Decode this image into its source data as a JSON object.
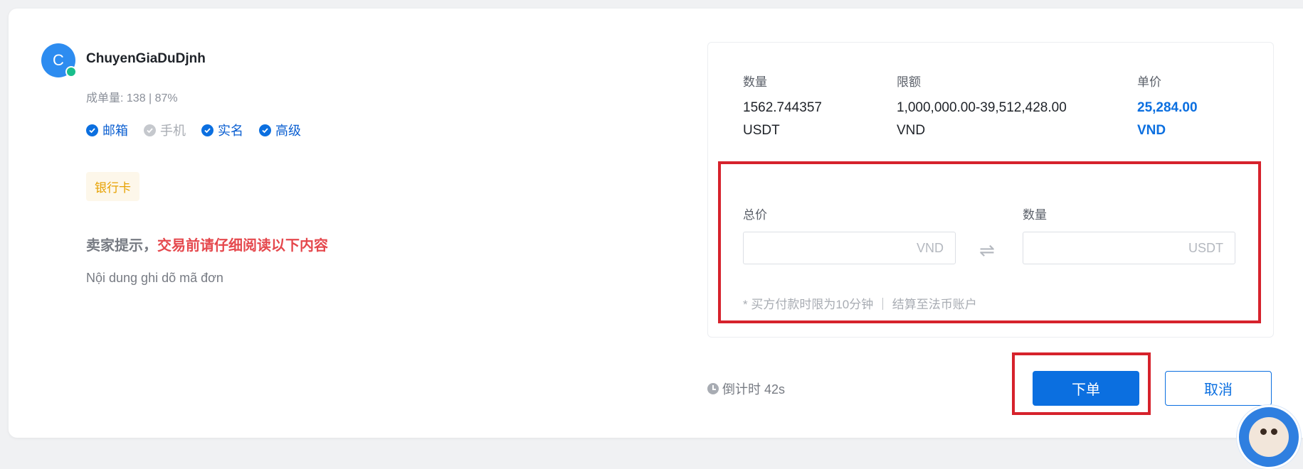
{
  "merchant": {
    "avatar_letter": "C",
    "name": "ChuyenGiaDuDjnh",
    "stats": "成单量: 138 | 87%",
    "verifications": [
      {
        "label": "邮箱",
        "verified": true
      },
      {
        "label": "手机",
        "verified": false
      },
      {
        "label": "实名",
        "verified": true
      },
      {
        "label": "高级",
        "verified": true
      }
    ],
    "payment_method": "银行卡",
    "notice_prefix": "卖家提示，",
    "notice_warning": "交易前请仔细阅读以下内容",
    "notice_body": "Nội dung ghi dõ mã đơn"
  },
  "order": {
    "quantity_label": "数量",
    "quantity_value": "1562.744357",
    "quantity_unit": "USDT",
    "limit_label": "限额",
    "limit_value": "1,000,000.00-39,512,428.00",
    "limit_unit": "VND",
    "price_label": "单价",
    "price_value": "25,284.00",
    "price_unit": "VND",
    "total_label": "总价",
    "total_placeholder": "VND",
    "amount_label": "数量",
    "amount_placeholder": "USDT",
    "swap_icon": "⇌",
    "hint": "* 买方付款时限为10分钟 ｜ 结算至法币账户"
  },
  "footer": {
    "countdown": "倒计时 42s",
    "submit_label": "下单",
    "cancel_label": "取消"
  },
  "colors": {
    "accent": "#0b6fe0",
    "highlight": "#d6222c",
    "warning": "#e5484d",
    "tag": "#e6a100"
  }
}
